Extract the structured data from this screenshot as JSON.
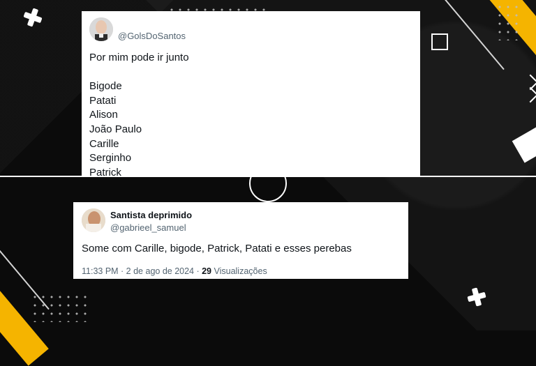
{
  "colors": {
    "accent": "#f5b400",
    "background": "#0b0b0b",
    "card": "#ffffff",
    "text_primary": "#0f1419",
    "text_secondary": "#536471"
  },
  "tweet1": {
    "avatar_icon": "user-avatar-photo",
    "handle": "@GolsDoSantos",
    "lines": [
      "Por mim pode ir junto",
      "",
      "Bigode",
      "Patati",
      "Alison",
      "João Paulo",
      "Carille",
      "Serginho",
      "Patrick"
    ]
  },
  "tweet2": {
    "avatar_icon": "user-avatar-photo",
    "display_name": "Santista deprimido",
    "handle": "@gabrieel_samuel",
    "text": "Some com Carille, bigode, Patrick, Patati e esses perebas",
    "time_date": "11:33 PM · 2 de ago de 2024 · ",
    "views_count": "29",
    "views_label": " Visualizações"
  }
}
